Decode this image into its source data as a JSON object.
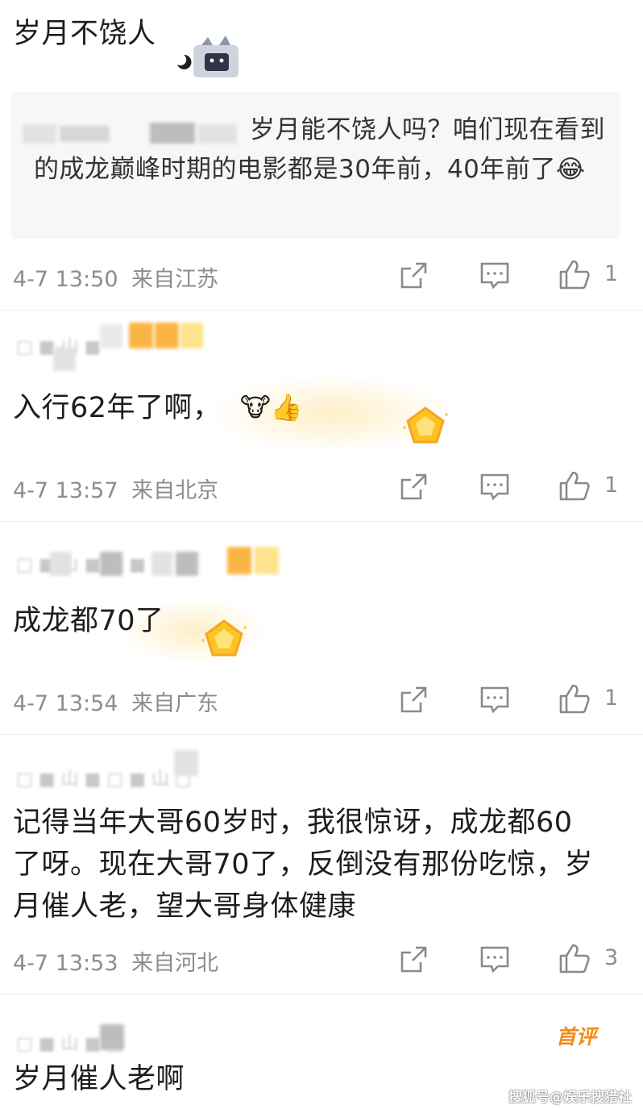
{
  "comments": [
    {
      "text": "岁月不饶人",
      "quote": "岁月能不饶人吗？咱们现在看到的成龙巅峰时期的电影都是30年前，40年前了😂",
      "time": "4-7 13:50",
      "location": "来自江苏",
      "likes": "1"
    },
    {
      "text": "入行62年了啊，",
      "emoji": "🐮👍",
      "time": "4-7 13:57",
      "location": "来自北京",
      "likes": "1"
    },
    {
      "text": "成龙都70了",
      "time": "4-7 13:54",
      "location": "来自广东",
      "likes": "1"
    },
    {
      "text": "记得当年大哥60岁时，我很惊讶，成龙都60了呀。现在大哥70了，反倒没有那份吃惊，岁月催人老，望大哥身体健康",
      "time": "4-7 13:53",
      "location": "来自河北",
      "likes": "3"
    },
    {
      "text": "岁月催人老啊",
      "badge": "首评"
    }
  ],
  "watermark": "搜狐号@娱乐搜猎社",
  "colors": {
    "meta_text": "#8c8c8c",
    "icon_stroke": "#8a8a8a",
    "badge_orange": "#f08a1a"
  }
}
